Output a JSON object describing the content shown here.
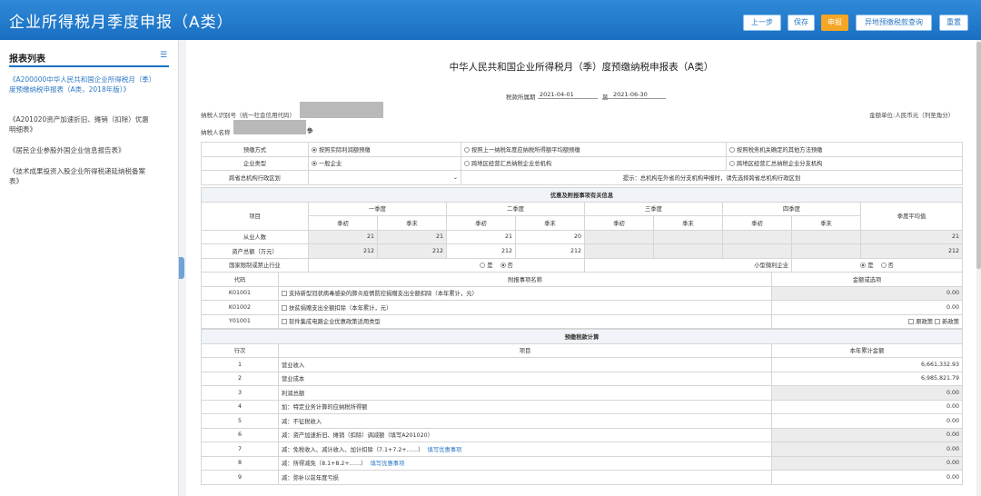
{
  "header": {
    "title": "企业所得税月季度申报（A类）",
    "buttons": {
      "prev": "上一步",
      "save": "保存",
      "submit": "申报",
      "query": "异地预缴税款查询",
      "reset": "重置"
    }
  },
  "sidebar": {
    "title": "报表列表",
    "items": [
      "《A200000中华人民共和国企业所得税月（季）度预缴纳税申报表（A类，2018年版）》",
      "《A201020资产加速折旧、摊销（扣除）优惠明细表》",
      "《居民企业参股外国企业信息报告表》",
      "《技术成果投资入股企业所得税递延纳税备案表》"
    ]
  },
  "form": {
    "title": "中华人民共和国企业所得税月（季）度预缴纳税申报表（A类）",
    "period_label": "税款所属期",
    "period_start": "2021-04-01",
    "period_to": "至",
    "period_end": "2021-06-30",
    "taxpayer_id_label": "纳税人识别号（统一社会信用代码）",
    "taxpayer_name_label": "纳税人名称",
    "name_suffix": "争",
    "unit_label": "金额单位:人民币元（列至角分）"
  },
  "basic": {
    "method_label": "预缴方式",
    "method_options": [
      "按照实际利润额预缴",
      "按照上一纳税年度应纳税所得额平均额预缴",
      "按照税务机关确定的其他方法预缴"
    ],
    "type_label": "企业类型",
    "type_options": [
      "一般企业",
      "跨地区经营汇总纳税企业总机构",
      "跨地区经营汇总纳税企业分支机构"
    ],
    "region_label": "跨省总机构行政区划",
    "region_tip": "提示：总机构在外省的分支机构申报时，请先选择跨省总机构行政区划"
  },
  "info": {
    "section": "优惠及附报事项有关信息",
    "item_header": "项目",
    "quarters": [
      "一季度",
      "二季度",
      "三季度",
      "四季度"
    ],
    "begin": "季初",
    "end": "季末",
    "avg_header": "季度平均值",
    "employees_label": "从业人数",
    "employees": [
      "21",
      "21",
      "21",
      "20"
    ],
    "employees_avg": "21",
    "assets_label": "资产总额（万元）",
    "assets": [
      "212",
      "212",
      "212",
      "212"
    ],
    "assets_avg": "212",
    "restricted_label": "国家限制或禁止行业",
    "yes": "是",
    "no": "否",
    "small_label": "小型微利企业"
  },
  "attach": {
    "code_header": "代码",
    "name_header": "附报事项名称",
    "amount_header": "金额或选项",
    "rows": [
      {
        "code": "K01001",
        "name": "支持新型冠状病毒感染的肺炎疫情防控捐赠支出全额扣除（本年累计，元）",
        "amount": "0.00"
      },
      {
        "code": "K01002",
        "name": "扶贫捐赠支出全额扣除（本年累计，元）",
        "amount": "0.00"
      },
      {
        "code": "Y01001",
        "name": "软件集成电路企业优惠政策适用类型",
        "amount": ""
      }
    ],
    "old_policy": "原政策",
    "new_policy": "新政策"
  },
  "calc": {
    "section": "预缴税款计算",
    "line_header": "行次",
    "item_header": "项目",
    "amount_header": "本年累计金额",
    "rows": [
      {
        "no": "1",
        "item": "营业收入",
        "link": "",
        "amount": "6,661,332.93"
      },
      {
        "no": "2",
        "item": "营业成本",
        "link": "",
        "amount": "6,985,821.79"
      },
      {
        "no": "3",
        "item": "利润总额",
        "link": "",
        "amount": "0.00"
      },
      {
        "no": "4",
        "item": "加：特定业务计算的应纳税所得额",
        "link": "",
        "amount": "0.00"
      },
      {
        "no": "5",
        "item": "减：不征税收入",
        "link": "",
        "amount": "0.00"
      },
      {
        "no": "6",
        "item": "减：资产加速折旧、摊销（扣除）调减额（填写A201020）",
        "link": "",
        "amount": "0.00"
      },
      {
        "no": "7",
        "item": "减：免税收入、减计收入、加计扣除（7.1+7.2+……）",
        "link": "填写优惠事项",
        "amount": "0.00"
      },
      {
        "no": "8",
        "item": "减：所得减免（8.1+8.2+……）",
        "link": "填写优惠事项",
        "amount": "0.00"
      },
      {
        "no": "9",
        "item": "减：弥补以前年度亏损",
        "link": "",
        "amount": "0.00"
      }
    ]
  }
}
